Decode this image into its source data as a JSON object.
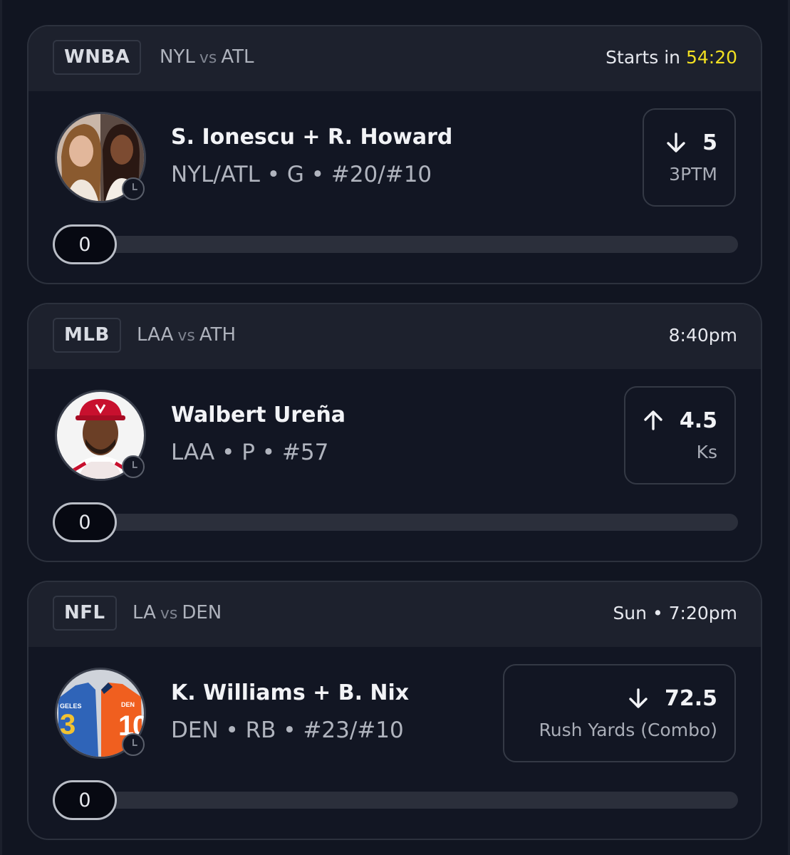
{
  "cards": [
    {
      "league": "WNBA",
      "matchup": {
        "away": "NYL",
        "vs": "vs",
        "home": "ATL"
      },
      "start": {
        "prefix": "Starts in ",
        "time": "54:20"
      },
      "player": {
        "name": "S. Ionescu + R. Howard",
        "meta": "NYL/ATL • G • #20/#10"
      },
      "line": {
        "direction": "down",
        "value": "5",
        "stat": "3PTM"
      },
      "progress": {
        "label": "0",
        "fraction": 0
      }
    },
    {
      "league": "MLB",
      "matchup": {
        "away": "LAA",
        "vs": "vs",
        "home": "ATH"
      },
      "start": {
        "prefix": "",
        "time": "8:40pm"
      },
      "player": {
        "name": "Walbert Ureña",
        "meta": "LAA • P • #57"
      },
      "line": {
        "direction": "up",
        "value": "4.5",
        "stat": "Ks"
      },
      "progress": {
        "label": "0",
        "fraction": 0
      }
    },
    {
      "league": "NFL",
      "matchup": {
        "away": "LA",
        "vs": "vs",
        "home": "DEN"
      },
      "start": {
        "prefix": "",
        "time": "Sun • 7:20pm"
      },
      "player": {
        "name": "K. Williams + B. Nix",
        "meta": "DEN • RB • #23/#10"
      },
      "line": {
        "direction": "down",
        "value": "72.5",
        "stat": "Rush Yards (Combo)"
      },
      "progress": {
        "label": "0",
        "fraction": 0
      }
    }
  ],
  "colors": {
    "background": "#111521",
    "card_header": "#1d212d",
    "countdown": "#f1df21",
    "text_primary": "#f2f3f6",
    "text_secondary": "#b0b4be"
  },
  "icons": [
    "clock-icon",
    "arrow-down-icon",
    "arrow-up-icon"
  ]
}
